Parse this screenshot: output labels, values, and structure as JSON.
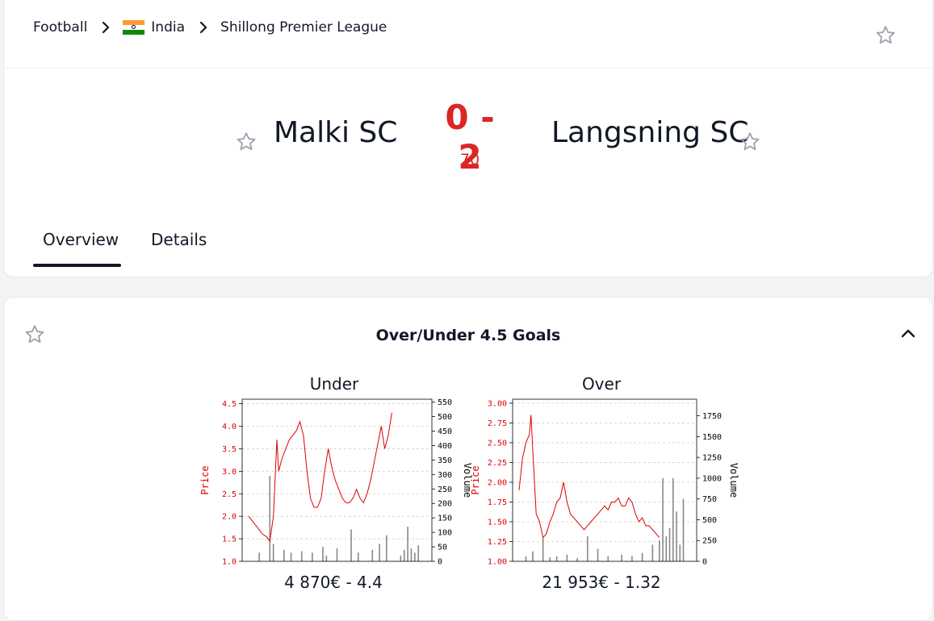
{
  "breadcrumb": {
    "sport": "Football",
    "country": "India",
    "league": "Shillong Premier League"
  },
  "match": {
    "home": "Malki SC",
    "away": "Langsning SC",
    "score": "0 - 2",
    "minute": "70"
  },
  "tabs": [
    {
      "label": "Overview",
      "active": true
    },
    {
      "label": "Details",
      "active": false
    }
  ],
  "market": {
    "title": "Over/Under 4.5 Goals"
  },
  "colors": {
    "live": "#dc2626",
    "price_line": "#dd0000",
    "volume_bar": "#888888",
    "star_outline": "#9ca3af",
    "india_saffron": "#ff9933",
    "india_green": "#138808"
  },
  "icons": [
    "chevron-right-icon",
    "india-flag-icon",
    "star-outline-icon",
    "chevron-up-icon"
  ],
  "chart_data": [
    {
      "type": "line",
      "title": "Under",
      "footer": "4 870€ - 4.4",
      "ylabel": "Price",
      "y2label": "Volume",
      "ylim": [
        1.0,
        4.6
      ],
      "y2lim": [
        0,
        560
      ],
      "yticks": [
        "1.0",
        "1.5",
        "2.0",
        "2.5",
        "3.0",
        "3.5",
        "4.0",
        "4.5"
      ],
      "y2ticks": [
        "0",
        "50",
        "100",
        "150",
        "200",
        "250",
        "300",
        "350",
        "400",
        "450",
        "500",
        "550"
      ],
      "grid": true,
      "price": {
        "x": [
          0,
          2,
          4,
          6,
          8,
          10,
          12,
          14,
          16,
          17,
          19,
          21,
          23,
          25,
          27,
          29,
          31,
          33,
          35,
          37,
          39,
          41,
          43,
          45,
          47,
          49,
          51,
          53,
          55,
          57,
          59,
          61,
          63,
          65,
          67,
          69,
          71,
          73,
          75,
          77,
          79,
          81,
          83,
          85,
          87,
          89,
          91,
          93,
          95,
          96,
          98,
          100
        ],
        "y": [
          2.0,
          1.9,
          1.8,
          1.7,
          1.6,
          1.55,
          1.45,
          2.0,
          3.7,
          3.0,
          3.3,
          3.5,
          3.7,
          3.8,
          3.9,
          4.1,
          3.8,
          3.0,
          2.4,
          2.2,
          2.2,
          2.4,
          3.0,
          3.5,
          3.1,
          2.8,
          2.6,
          2.4,
          2.3,
          2.3,
          2.4,
          2.6,
          2.4,
          2.3,
          2.5,
          2.8,
          3.2,
          3.6,
          4.0,
          3.5,
          3.8,
          4.3
        ]
      },
      "volume": {
        "x": [
          6,
          12,
          14,
          20,
          24,
          30,
          36,
          42,
          44,
          50,
          58,
          62,
          70,
          74,
          78,
          86,
          88,
          90,
          92,
          94,
          96
        ],
        "y": [
          30,
          295,
          60,
          40,
          30,
          35,
          30,
          50,
          20,
          45,
          110,
          30,
          40,
          60,
          90,
          20,
          40,
          120,
          45,
          30,
          55
        ]
      }
    },
    {
      "type": "line",
      "title": "Over",
      "footer": "21 953€ - 1.32",
      "ylabel": "Price",
      "y2label": "Volume",
      "ylim": [
        1.0,
        3.05
      ],
      "y2lim": [
        0,
        1950
      ],
      "yticks": [
        "1.00",
        "1.25",
        "1.50",
        "1.75",
        "2.00",
        "2.25",
        "2.50",
        "2.75",
        "3.00"
      ],
      "y2ticks": [
        "0",
        "250",
        "500",
        "750",
        "1000",
        "1250",
        "1500",
        "1750"
      ],
      "grid": true,
      "price": {
        "x": [
          0,
          2,
          4,
          6,
          7,
          8,
          9,
          10,
          12,
          14,
          16,
          18,
          20,
          22,
          24,
          26,
          28,
          30,
          32,
          34,
          36,
          38,
          40,
          42,
          44,
          46,
          48,
          50,
          52,
          54,
          56,
          58,
          60,
          62,
          64,
          66,
          68,
          70,
          72,
          74,
          76,
          78,
          80,
          82,
          84,
          86,
          88,
          90,
          92,
          94,
          96,
          98,
          100
        ],
        "y": [
          1.9,
          2.3,
          2.5,
          2.6,
          2.85,
          2.4,
          2.0,
          1.6,
          1.5,
          1.3,
          1.35,
          1.5,
          1.6,
          1.75,
          1.8,
          2.0,
          1.75,
          1.6,
          1.55,
          1.5,
          1.45,
          1.4,
          1.45,
          1.5,
          1.55,
          1.6,
          1.65,
          1.7,
          1.65,
          1.75,
          1.75,
          1.8,
          1.7,
          1.7,
          1.8,
          1.75,
          1.6,
          1.5,
          1.55,
          1.45,
          1.45,
          1.4,
          1.35,
          1.3
        ]
      },
      "volume": {
        "x": [
          4,
          8,
          14,
          18,
          22,
          28,
          34,
          40,
          46,
          52,
          60,
          66,
          72,
          78,
          82,
          84,
          86,
          88,
          90,
          92,
          94,
          96
        ],
        "y": [
          60,
          120,
          280,
          50,
          60,
          80,
          40,
          300,
          150,
          60,
          80,
          60,
          100,
          200,
          250,
          1000,
          300,
          400,
          1000,
          600,
          200,
          750
        ]
      }
    }
  ]
}
